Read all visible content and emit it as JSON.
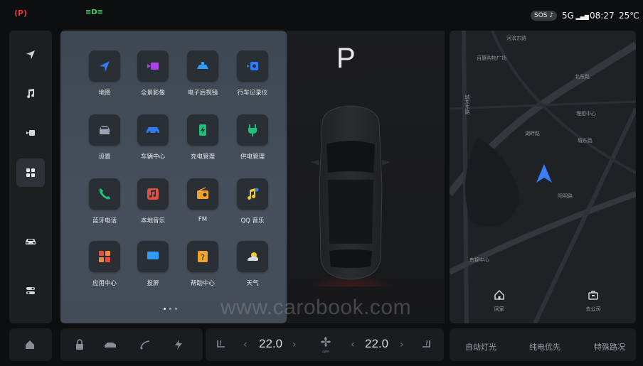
{
  "status_bar": {
    "sos_label": "SOS",
    "network": "5G",
    "time": "08:27",
    "temperature": "25℃"
  },
  "left_rail": {
    "items": [
      {
        "name": "navigation",
        "icon": "navigation-arrow-icon"
      },
      {
        "name": "music",
        "icon": "music-note-icon"
      },
      {
        "name": "video",
        "icon": "camera-icon"
      },
      {
        "name": "apps",
        "icon": "grid-icon",
        "active": true
      },
      {
        "name": "vehicle",
        "icon": "car-icon"
      },
      {
        "name": "settings",
        "icon": "toggle-icon"
      }
    ]
  },
  "launcher": {
    "apps": [
      {
        "label": "地图",
        "icon": "map-arrow-icon",
        "color": "#2f7cf6"
      },
      {
        "label": "全景影像",
        "icon": "panorama-camera-icon",
        "color": "#a845e8"
      },
      {
        "label": "电子后视镜",
        "icon": "rear-mirror-icon",
        "color": "#2f9bf6"
      },
      {
        "label": "行车记录仪",
        "icon": "dashcam-icon",
        "color": "#2f7cf6"
      },
      {
        "label": "设置",
        "icon": "settings-car-icon",
        "color": "#9aa3b1"
      },
      {
        "label": "车辆中心",
        "icon": "vehicle-center-icon",
        "color": "#2f7cf6"
      },
      {
        "label": "充电管理",
        "icon": "battery-charge-icon",
        "color": "#1fbf7a"
      },
      {
        "label": "供电管理",
        "icon": "power-plug-icon",
        "color": "#1fbf7a"
      },
      {
        "label": "蓝牙电话",
        "icon": "phone-icon",
        "color": "#1fbf7a"
      },
      {
        "label": "本地音乐",
        "icon": "local-music-icon",
        "color": "#e4503f"
      },
      {
        "label": "FM",
        "icon": "radio-icon",
        "color": "#f0a42a"
      },
      {
        "label": "QQ 音乐",
        "icon": "qq-music-icon",
        "color": "#f0c830"
      },
      {
        "label": "应用中心",
        "icon": "app-center-icon",
        "color": "#e4503f"
      },
      {
        "label": "投屏",
        "icon": "screen-cast-icon",
        "color": "#2f9bf6"
      },
      {
        "label": "帮助中心",
        "icon": "help-center-icon",
        "color": "#f0a42a"
      },
      {
        "label": "天气",
        "icon": "weather-cloud-icon",
        "color": "#f0c830"
      }
    ],
    "page_count": 3,
    "current_page": 1
  },
  "vehicle_view": {
    "gear": "P"
  },
  "watermark": "www.carobook.com",
  "map": {
    "labels": [
      "河滨东路",
      "百惠购物广场",
      "城东东路",
      "理想中心",
      "湖畔路",
      "北东路",
      "城东路",
      "阳明路",
      "东锦中心"
    ],
    "buttons": [
      {
        "label": "回家",
        "icon": "home-icon"
      },
      {
        "label": "去公司",
        "icon": "briefcase-icon"
      }
    ]
  },
  "dock": {
    "left_temp": "22.0",
    "right_temp": "22.0",
    "fan_label": "OFF",
    "quick_actions": [
      "自动灯光",
      "纯电优先",
      "特殊路况"
    ]
  }
}
